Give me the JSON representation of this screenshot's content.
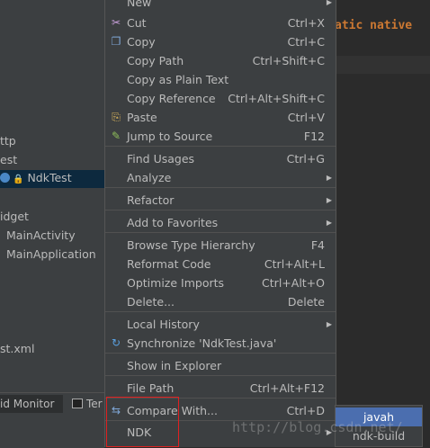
{
  "tree": {
    "items": [
      {
        "label": "ttp"
      },
      {
        "label": "est"
      },
      {
        "label": "NdkTest"
      },
      {
        "label": "idget"
      },
      {
        "label": "MainActivity"
      },
      {
        "label": "MainApplication"
      },
      {
        "label": "st.xml"
      }
    ]
  },
  "toolstrip": {
    "monitor_label": "id Monitor",
    "terminal_label": "Ter"
  },
  "editor": {
    "line1": "atic native",
    "watermark": "http://blog.csdn.net/"
  },
  "menu": {
    "items": [
      {
        "label": "New",
        "shortcut": "",
        "icon": "",
        "submenu": true
      },
      {
        "label": "Cut",
        "shortcut": "Ctrl+X",
        "icon": "scissors-icon"
      },
      {
        "label": "Copy",
        "shortcut": "Ctrl+C",
        "icon": "copy-icon"
      },
      {
        "label": "Copy Path",
        "shortcut": "Ctrl+Shift+C"
      },
      {
        "label": "Copy as Plain Text",
        "shortcut": ""
      },
      {
        "label": "Copy Reference",
        "shortcut": "Ctrl+Alt+Shift+C"
      },
      {
        "label": "Paste",
        "shortcut": "Ctrl+V",
        "icon": "paste-icon"
      },
      {
        "label": "Jump to Source",
        "shortcut": "F12",
        "icon": "edit-source-icon"
      },
      {
        "label": "Find Usages",
        "shortcut": "Ctrl+G"
      },
      {
        "label": "Analyze",
        "shortcut": "",
        "submenu": true
      },
      {
        "label": "Refactor",
        "shortcut": "",
        "submenu": true
      },
      {
        "label": "Add to Favorites",
        "shortcut": "",
        "submenu": true
      },
      {
        "label": "Browse Type Hierarchy",
        "shortcut": "F4"
      },
      {
        "label": "Reformat Code",
        "shortcut": "Ctrl+Alt+L"
      },
      {
        "label": "Optimize Imports",
        "shortcut": "Ctrl+Alt+O"
      },
      {
        "label": "Delete...",
        "shortcut": "Delete"
      },
      {
        "label": "Local History",
        "shortcut": "",
        "submenu": true
      },
      {
        "label": "Synchronize 'NdkTest.java'",
        "shortcut": "",
        "icon": "sync-icon"
      },
      {
        "label": "Show in Explorer",
        "shortcut": ""
      },
      {
        "label": "File Path",
        "shortcut": "Ctrl+Alt+F12"
      },
      {
        "label": "Compare With...",
        "shortcut": "Ctrl+D",
        "icon": "compare-icon"
      },
      {
        "label": "NDK",
        "shortcut": "",
        "submenu": true
      }
    ]
  },
  "submenu": {
    "items": [
      {
        "label": "javah"
      },
      {
        "label": "ndk-build"
      }
    ]
  },
  "colors": {
    "menu_bg": "#3c3f41",
    "highlight": "#4b6eaf",
    "annotation_red": "#e02020",
    "keyword": "#cc7832"
  }
}
